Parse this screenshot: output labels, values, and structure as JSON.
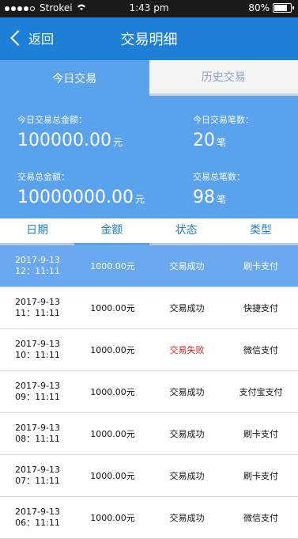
{
  "status_bar": {
    "carrier": "Strokei",
    "time": "1:43 pm",
    "battery": "80%"
  },
  "nav": {
    "back_label": "返回",
    "title": "交易明细"
  },
  "tabs": [
    {
      "label": "今日交易"
    },
    {
      "label": "历史交易"
    }
  ],
  "summary": {
    "today_amount_label": "今日交易总金额：",
    "today_amount_value": "100000.00",
    "today_amount_unit": "元",
    "today_count_label": "今日交易笔数：",
    "today_count_value": "20",
    "today_count_unit": "笔",
    "total_amount_label": "交易总金额：",
    "total_amount_value": "10000000.00",
    "total_amount_unit": "元",
    "total_count_label": "交易总笔数：",
    "total_count_value": "98",
    "total_count_unit": "笔"
  },
  "columns": [
    "日期",
    "金额",
    "状态",
    "类型"
  ],
  "transactions": [
    {
      "date": "2017-9-13",
      "time": "12：11:11",
      "amount": "1000.00元",
      "status": "交易成功",
      "type": "刷卡支付"
    },
    {
      "date": "2017-9-13",
      "time": "11：11:11",
      "amount": "1000.00元",
      "status": "交易成功",
      "type": "快捷支付"
    },
    {
      "date": "2017-9-13",
      "time": "10：11:11",
      "amount": "1000.00元",
      "status": "交易失败",
      "type": "微信支付"
    },
    {
      "date": "2017-9-13",
      "time": "09：11:11",
      "amount": "1000.00元",
      "status": "交易成功",
      "type": "支付宝支付"
    },
    {
      "date": "2017-9-13",
      "time": "08：11:11",
      "amount": "1000.00元",
      "status": "交易成功",
      "type": "刷卡支付"
    },
    {
      "date": "2017-9-13",
      "time": "07：11:11",
      "amount": "1000.00元",
      "status": "交易成功",
      "type": "刷卡支付"
    },
    {
      "date": "2017-9-13",
      "time": "06：11:11",
      "amount": "1000.00元",
      "status": "交易成功",
      "type": "微信支付"
    }
  ],
  "colors": {
    "primary": "#1e7fd6",
    "accent": "#5aa2ec",
    "fail": "#e02020"
  }
}
